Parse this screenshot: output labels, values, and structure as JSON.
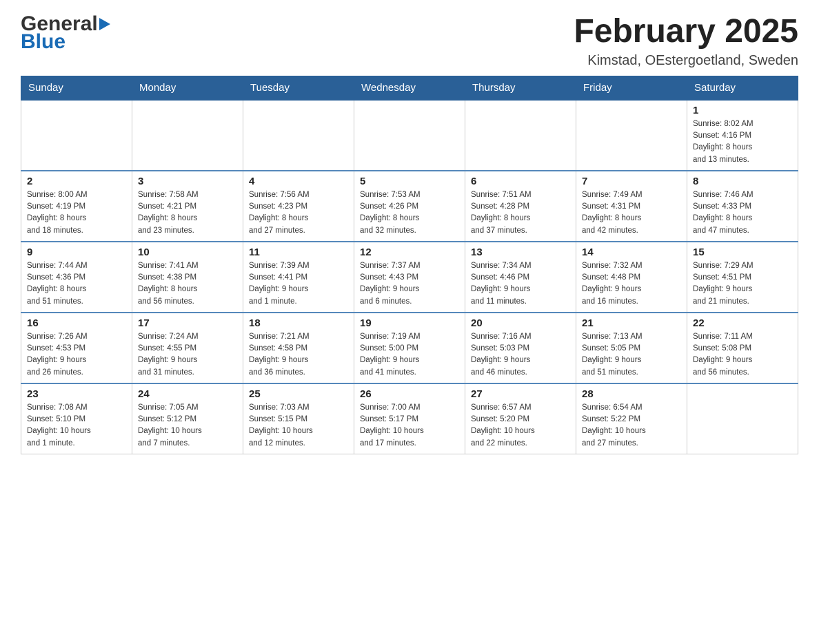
{
  "header": {
    "logo_general": "General",
    "logo_blue": "Blue",
    "month_title": "February 2025",
    "location": "Kimstad, OEstergoetland, Sweden"
  },
  "days_of_week": [
    "Sunday",
    "Monday",
    "Tuesday",
    "Wednesday",
    "Thursday",
    "Friday",
    "Saturday"
  ],
  "weeks": [
    [
      {
        "day": "",
        "info": ""
      },
      {
        "day": "",
        "info": ""
      },
      {
        "day": "",
        "info": ""
      },
      {
        "day": "",
        "info": ""
      },
      {
        "day": "",
        "info": ""
      },
      {
        "day": "",
        "info": ""
      },
      {
        "day": "1",
        "info": "Sunrise: 8:02 AM\nSunset: 4:16 PM\nDaylight: 8 hours\nand 13 minutes."
      }
    ],
    [
      {
        "day": "2",
        "info": "Sunrise: 8:00 AM\nSunset: 4:19 PM\nDaylight: 8 hours\nand 18 minutes."
      },
      {
        "day": "3",
        "info": "Sunrise: 7:58 AM\nSunset: 4:21 PM\nDaylight: 8 hours\nand 23 minutes."
      },
      {
        "day": "4",
        "info": "Sunrise: 7:56 AM\nSunset: 4:23 PM\nDaylight: 8 hours\nand 27 minutes."
      },
      {
        "day": "5",
        "info": "Sunrise: 7:53 AM\nSunset: 4:26 PM\nDaylight: 8 hours\nand 32 minutes."
      },
      {
        "day": "6",
        "info": "Sunrise: 7:51 AM\nSunset: 4:28 PM\nDaylight: 8 hours\nand 37 minutes."
      },
      {
        "day": "7",
        "info": "Sunrise: 7:49 AM\nSunset: 4:31 PM\nDaylight: 8 hours\nand 42 minutes."
      },
      {
        "day": "8",
        "info": "Sunrise: 7:46 AM\nSunset: 4:33 PM\nDaylight: 8 hours\nand 47 minutes."
      }
    ],
    [
      {
        "day": "9",
        "info": "Sunrise: 7:44 AM\nSunset: 4:36 PM\nDaylight: 8 hours\nand 51 minutes."
      },
      {
        "day": "10",
        "info": "Sunrise: 7:41 AM\nSunset: 4:38 PM\nDaylight: 8 hours\nand 56 minutes."
      },
      {
        "day": "11",
        "info": "Sunrise: 7:39 AM\nSunset: 4:41 PM\nDaylight: 9 hours\nand 1 minute."
      },
      {
        "day": "12",
        "info": "Sunrise: 7:37 AM\nSunset: 4:43 PM\nDaylight: 9 hours\nand 6 minutes."
      },
      {
        "day": "13",
        "info": "Sunrise: 7:34 AM\nSunset: 4:46 PM\nDaylight: 9 hours\nand 11 minutes."
      },
      {
        "day": "14",
        "info": "Sunrise: 7:32 AM\nSunset: 4:48 PM\nDaylight: 9 hours\nand 16 minutes."
      },
      {
        "day": "15",
        "info": "Sunrise: 7:29 AM\nSunset: 4:51 PM\nDaylight: 9 hours\nand 21 minutes."
      }
    ],
    [
      {
        "day": "16",
        "info": "Sunrise: 7:26 AM\nSunset: 4:53 PM\nDaylight: 9 hours\nand 26 minutes."
      },
      {
        "day": "17",
        "info": "Sunrise: 7:24 AM\nSunset: 4:55 PM\nDaylight: 9 hours\nand 31 minutes."
      },
      {
        "day": "18",
        "info": "Sunrise: 7:21 AM\nSunset: 4:58 PM\nDaylight: 9 hours\nand 36 minutes."
      },
      {
        "day": "19",
        "info": "Sunrise: 7:19 AM\nSunset: 5:00 PM\nDaylight: 9 hours\nand 41 minutes."
      },
      {
        "day": "20",
        "info": "Sunrise: 7:16 AM\nSunset: 5:03 PM\nDaylight: 9 hours\nand 46 minutes."
      },
      {
        "day": "21",
        "info": "Sunrise: 7:13 AM\nSunset: 5:05 PM\nDaylight: 9 hours\nand 51 minutes."
      },
      {
        "day": "22",
        "info": "Sunrise: 7:11 AM\nSunset: 5:08 PM\nDaylight: 9 hours\nand 56 minutes."
      }
    ],
    [
      {
        "day": "23",
        "info": "Sunrise: 7:08 AM\nSunset: 5:10 PM\nDaylight: 10 hours\nand 1 minute."
      },
      {
        "day": "24",
        "info": "Sunrise: 7:05 AM\nSunset: 5:12 PM\nDaylight: 10 hours\nand 7 minutes."
      },
      {
        "day": "25",
        "info": "Sunrise: 7:03 AM\nSunset: 5:15 PM\nDaylight: 10 hours\nand 12 minutes."
      },
      {
        "day": "26",
        "info": "Sunrise: 7:00 AM\nSunset: 5:17 PM\nDaylight: 10 hours\nand 17 minutes."
      },
      {
        "day": "27",
        "info": "Sunrise: 6:57 AM\nSunset: 5:20 PM\nDaylight: 10 hours\nand 22 minutes."
      },
      {
        "day": "28",
        "info": "Sunrise: 6:54 AM\nSunset: 5:22 PM\nDaylight: 10 hours\nand 27 minutes."
      },
      {
        "day": "",
        "info": ""
      }
    ]
  ]
}
